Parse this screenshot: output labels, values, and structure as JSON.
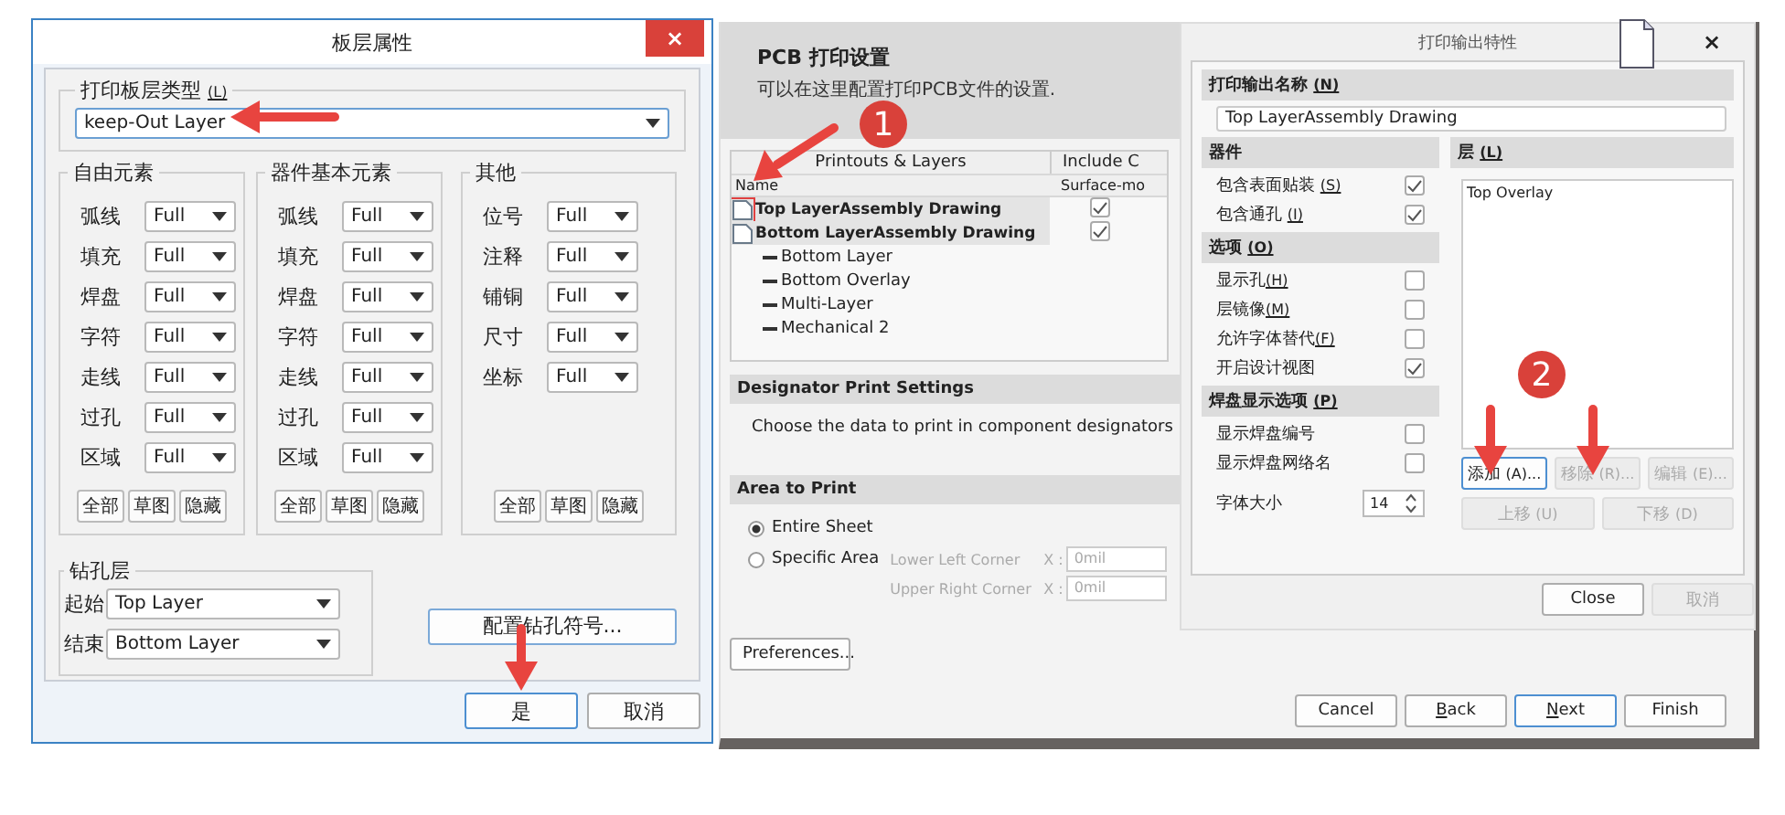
{
  "layer_dialog": {
    "title": "板层属性",
    "close": "×",
    "print_layer_type": {
      "label": "打印板层类型",
      "mnemonic": "(L)",
      "value": "keep-Out Layer"
    },
    "groups": [
      {
        "title": "自由元素",
        "rows": [
          {
            "label": "弧线",
            "value": "Full"
          },
          {
            "label": "填充",
            "value": "Full"
          },
          {
            "label": "焊盘",
            "value": "Full"
          },
          {
            "label": "字符",
            "value": "Full"
          },
          {
            "label": "走线",
            "value": "Full"
          },
          {
            "label": "过孔",
            "value": "Full"
          },
          {
            "label": "区域",
            "value": "Full"
          }
        ],
        "buttons": [
          "全部",
          "草图",
          "隐藏"
        ]
      },
      {
        "title": "器件基本元素",
        "rows": [
          {
            "label": "弧线",
            "value": "Full"
          },
          {
            "label": "填充",
            "value": "Full"
          },
          {
            "label": "焊盘",
            "value": "Full"
          },
          {
            "label": "字符",
            "value": "Full"
          },
          {
            "label": "走线",
            "value": "Full"
          },
          {
            "label": "过孔",
            "value": "Full"
          },
          {
            "label": "区域",
            "value": "Full"
          }
        ],
        "buttons": [
          "全部",
          "草图",
          "隐藏"
        ]
      },
      {
        "title": "其他",
        "rows": [
          {
            "label": "位号",
            "value": "Full"
          },
          {
            "label": "注释",
            "value": "Full"
          },
          {
            "label": "铺铜",
            "value": "Full"
          },
          {
            "label": "尺寸",
            "value": "Full"
          },
          {
            "label": "坐标",
            "value": "Full"
          }
        ],
        "buttons": [
          "全部",
          "草图",
          "隐藏"
        ]
      }
    ],
    "drill": {
      "title": "钻孔层",
      "rows": [
        {
          "label": "起始",
          "value": "Top Layer"
        },
        {
          "label": "结束",
          "value": "Bottom Layer"
        }
      ]
    },
    "drill_symbols_button": "配置钻孔符号...",
    "buttons": [
      {
        "label": "是",
        "default": true
      },
      {
        "label": "取消",
        "default": false
      }
    ]
  },
  "wizard": {
    "title": "PCB 打印设置",
    "subtitle": "可以在这里配置打印PCB文件的设置.",
    "table": {
      "group_headers": [
        "Printouts & Layers",
        "Include C"
      ],
      "columns": [
        "Name",
        "Surface-mo"
      ],
      "rows": [
        {
          "name": "Top LayerAssembly Drawing",
          "checked": true,
          "marked": true,
          "children": []
        },
        {
          "name": "Bottom LayerAssembly Drawing",
          "checked": true,
          "marked": false,
          "children": [
            {
              "name": "Bottom Layer"
            },
            {
              "name": "Bottom Overlay"
            },
            {
              "name": "Multi-Layer"
            },
            {
              "name": "Mechanical 2"
            }
          ]
        }
      ]
    },
    "designator": {
      "title": "Designator Print Settings",
      "text": "Choose the data to print in component designators"
    },
    "area": {
      "title": "Area to Print",
      "options": [
        {
          "label": "Entire Sheet",
          "selected": true
        },
        {
          "label": "Specific Area",
          "selected": false
        }
      ],
      "fields": [
        {
          "label": "Lower Left Corner",
          "axis": "X :",
          "value": "0mil"
        },
        {
          "label": "Upper Right Corner",
          "axis": "X :",
          "value": "0mil"
        }
      ]
    },
    "preferences_button": "Preferences...",
    "nav_buttons": [
      {
        "label": "Cancel",
        "underline_first": false,
        "default": false
      },
      {
        "label": "Back",
        "underline_first": true,
        "default": false
      },
      {
        "label": "Next",
        "underline_first": true,
        "default": true
      },
      {
        "label": "Finish",
        "underline_first": false,
        "default": false
      }
    ]
  },
  "props_dialog": {
    "title": "打印输出特性",
    "close": "×",
    "name_section": {
      "title": "打印输出名称",
      "mnemonic": "(N)",
      "value": "Top LayerAssembly Drawing"
    },
    "components": {
      "title": "器件",
      "items": [
        {
          "label": "包含表面贴装",
          "mnemonic": "(S)",
          "checked": true
        },
        {
          "label": "包含通孔",
          "mnemonic": "(I)",
          "checked": true
        }
      ]
    },
    "options": {
      "title": "选项",
      "mnemonic": "(O)",
      "items": [
        {
          "label": "显示孔",
          "mnemonic": "(H)",
          "checked": false
        },
        {
          "label": "层镜像",
          "mnemonic": "(M)",
          "checked": false
        },
        {
          "label": "允许字体替代",
          "mnemonic": "(F)",
          "checked": false
        },
        {
          "label": "开启设计视图",
          "checked": true
        }
      ]
    },
    "pad_options": {
      "title": "焊盘显示选项",
      "mnemonic": "(P)",
      "items": [
        {
          "label": "显示焊盘编号",
          "checked": false
        },
        {
          "label": "显示焊盘网络名",
          "checked": false
        }
      ]
    },
    "font_size": {
      "label": "字体大小",
      "value": "14"
    },
    "layers": {
      "title": "层",
      "mnemonic": "(L)",
      "items": [
        "Top Overlay"
      ]
    },
    "layer_buttons": [
      {
        "label": "添加",
        "mnemonic": "(A)...",
        "disabled": false
      },
      {
        "label": "移除",
        "mnemonic": "(R)...",
        "disabled": true
      },
      {
        "label": "编辑",
        "mnemonic": "(E)...",
        "disabled": true
      }
    ],
    "move_buttons": [
      {
        "label": "上移",
        "mnemonic": "(U)",
        "disabled": true
      },
      {
        "label": "下移",
        "mnemonic": "(D)",
        "disabled": true
      }
    ],
    "buttons": [
      {
        "label": "Close",
        "disabled": false
      },
      {
        "label": "取消",
        "disabled": true
      }
    ]
  },
  "annotations": [
    {
      "kind": "number",
      "text": "1"
    },
    {
      "kind": "number",
      "text": "2"
    }
  ]
}
